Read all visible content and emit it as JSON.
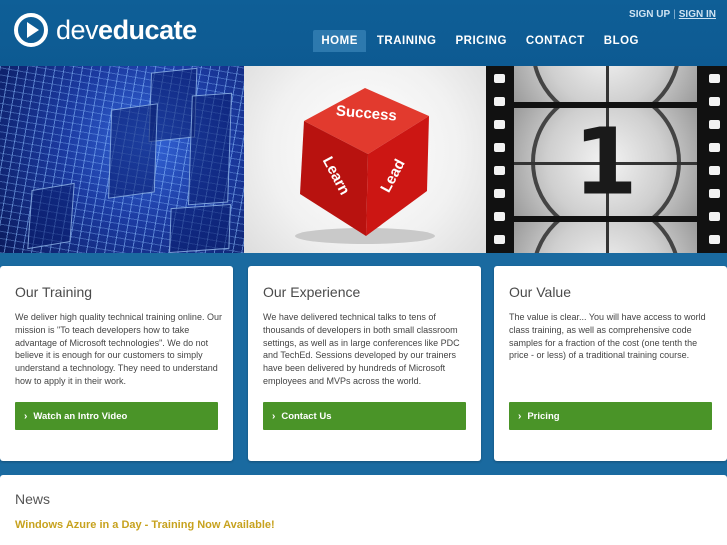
{
  "brand": {
    "name_light": "dev",
    "name_bold": "educate"
  },
  "auth": {
    "signup": "SIGN UP",
    "separator": "|",
    "signin": "SIGN IN"
  },
  "nav": [
    {
      "label": "HOME",
      "active": true
    },
    {
      "label": "TRAINING",
      "active": false
    },
    {
      "label": "PRICING",
      "active": false
    },
    {
      "label": "CONTACT",
      "active": false
    },
    {
      "label": "BLOG",
      "active": false
    }
  ],
  "banner": {
    "dice": {
      "top": "Success",
      "left": "Learn",
      "right": "Lead"
    },
    "countdown": "1"
  },
  "cards": [
    {
      "title": "Our Training",
      "body": "We deliver high quality technical training online. Our mission is \"To teach developers how to take advantage of Microsoft technologies\". We do not believe it is enough for our customers to simply understand a technology. They need to understand how to apply it in their work.",
      "button": "Watch an Intro Video"
    },
    {
      "title": "Our Experience",
      "body": "We have delivered technical talks to tens of thousands of developers in both small classroom settings, as well as in large conferences like PDC and TechEd.  Sessions developed by our trainers have been delivered by hundreds of Microsoft employees and MVPs across the world.",
      "button": "Contact Us"
    },
    {
      "title": "Our Value",
      "body": "The value is clear... You will have access to world class training, as well as comprehensive code samples for a fraction of the cost (one tenth the price - or less) of a traditional training course.",
      "button": "Pricing"
    }
  ],
  "news": {
    "title": "News",
    "items": [
      "Windows Azure in a Day - Training Now Available!"
    ]
  },
  "colors": {
    "header_bg": "#0f5f97",
    "page_bg": "#1a6aa0",
    "button_green": "#4a9428",
    "news_link": "#c7a21e",
    "dice_red": "#d81c1c"
  }
}
